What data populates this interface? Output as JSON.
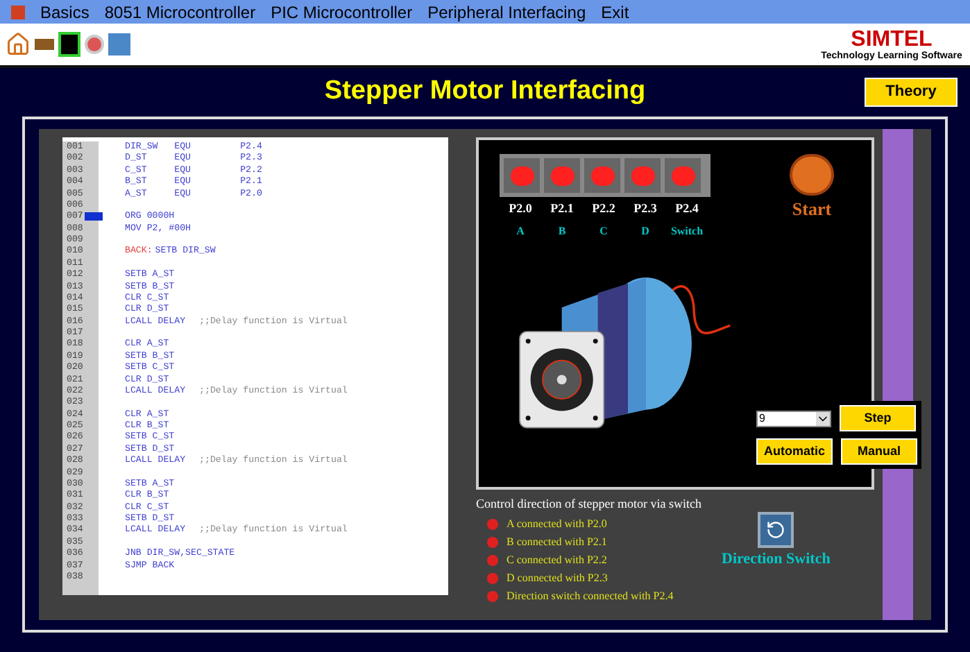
{
  "menu": [
    "Basics",
    "8051 Microcontroller",
    "PIC Microcontroller",
    "Peripheral Interfacing",
    "Exit"
  ],
  "logo": {
    "name": "SIMTEL",
    "tagline": "Technology Learning Software"
  },
  "title": "Stepper Motor Interfacing",
  "theory_button": "Theory",
  "code": [
    {
      "number": "001",
      "code": "DIR_SW   EQU         P2.4",
      "current": false
    },
    {
      "number": "002",
      "code": "D_ST     EQU         P2.3",
      "current": false
    },
    {
      "number": "003",
      "code": "C_ST     EQU         P2.2",
      "current": false
    },
    {
      "number": "004",
      "code": "B_ST     EQU         P2.1",
      "current": false
    },
    {
      "number": "005",
      "code": "A_ST     EQU         P2.0",
      "current": false
    },
    {
      "number": "006",
      "current": false
    },
    {
      "number": "007",
      "code": "ORG 0000H",
      "current": true
    },
    {
      "number": "008",
      "code": "MOV P2, #00H",
      "current": false
    },
    {
      "number": "009",
      "current": false
    },
    {
      "number": "010",
      "label": "BACK:",
      "code": "SETB DIR_SW",
      "current": false
    },
    {
      "number": "011",
      "current": false
    },
    {
      "number": "012",
      "code": "SETB A_ST",
      "current": false
    },
    {
      "number": "013",
      "code": "SETB B_ST",
      "current": false
    },
    {
      "number": "014",
      "code": "CLR C_ST",
      "current": false
    },
    {
      "number": "015",
      "code": "CLR D_ST",
      "current": false
    },
    {
      "number": "016",
      "code": "LCALL DELAY",
      "comment": ";;Delay function is Virtual",
      "current": false
    },
    {
      "number": "017",
      "current": false
    },
    {
      "number": "018",
      "code": "CLR A_ST",
      "current": false
    },
    {
      "number": "019",
      "code": "SETB B_ST",
      "current": false
    },
    {
      "number": "020",
      "code": "SETB C_ST",
      "current": false
    },
    {
      "number": "021",
      "code": "CLR D_ST",
      "current": false
    },
    {
      "number": "022",
      "code": "LCALL DELAY",
      "comment": ";;Delay function is Virtual",
      "current": false
    },
    {
      "number": "023",
      "current": false
    },
    {
      "number": "024",
      "code": "CLR A_ST",
      "current": false
    },
    {
      "number": "025",
      "code": "CLR B_ST",
      "current": false
    },
    {
      "number": "026",
      "code": "SETB C_ST",
      "current": false
    },
    {
      "number": "027",
      "code": "SETB D_ST",
      "current": false
    },
    {
      "number": "028",
      "code": "LCALL DELAY",
      "comment": ";;Delay function is Virtual",
      "current": false
    },
    {
      "number": "029",
      "current": false
    },
    {
      "number": "030",
      "code": "SETB A_ST",
      "current": false
    },
    {
      "number": "031",
      "code": "CLR B_ST",
      "current": false
    },
    {
      "number": "032",
      "code": "CLR C_ST",
      "current": false
    },
    {
      "number": "033",
      "code": "SETB D_ST",
      "current": false
    },
    {
      "number": "034",
      "code": "LCALL DELAY",
      "comment": ";;Delay function is Virtual",
      "current": false
    },
    {
      "number": "035",
      "current": false
    },
    {
      "number": "036",
      "code": "JNB DIR_SW,SEC_STATE",
      "current": false
    },
    {
      "number": "037",
      "code": "SJMP BACK",
      "current": false
    },
    {
      "number": "038",
      "current": false
    }
  ],
  "leds": [
    {
      "port": "P2.0",
      "name": "A",
      "on": true
    },
    {
      "port": "P2.1",
      "name": "B",
      "on": true
    },
    {
      "port": "P2.2",
      "name": "C",
      "on": true
    },
    {
      "port": "P2.3",
      "name": "D",
      "on": true
    },
    {
      "port": "P2.4",
      "name": "Switch",
      "on": true
    }
  ],
  "start_label": "Start",
  "step_select": {
    "value": "9"
  },
  "buttons": {
    "step": "Step",
    "automatic": "Automatic",
    "manual": "Manual"
  },
  "info_title": "Control direction of stepper motor via switch",
  "info_items": [
    "A connected with P2.0",
    "B connected with P2.1",
    "C connected with P2.2",
    "D connected with P2.3",
    "Direction switch connected with P2.4"
  ],
  "direction_switch": "Direction Switch"
}
